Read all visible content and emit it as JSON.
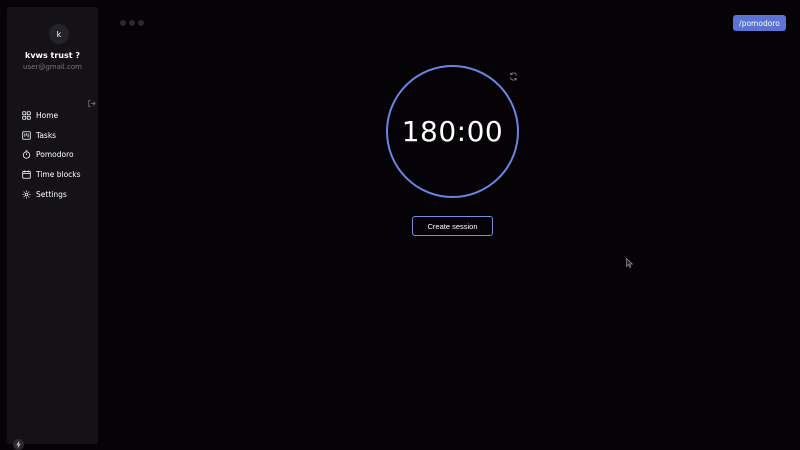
{
  "user": {
    "avatar_letter": "k",
    "name": "kvws trust ?",
    "email": "user@gmail.com"
  },
  "sidebar": {
    "items": [
      {
        "label": "Home",
        "icon": "grid-icon"
      },
      {
        "label": "Tasks",
        "icon": "kanban-icon"
      },
      {
        "label": "Pomodoro",
        "icon": "timer-icon"
      },
      {
        "label": "Time blocks",
        "icon": "calendar-icon"
      },
      {
        "label": "Settings",
        "icon": "gear-icon"
      }
    ]
  },
  "header": {
    "route": "/pomodoro"
  },
  "timer": {
    "display": "180:00"
  },
  "actions": {
    "create_session": "Create session"
  },
  "colors": {
    "background": "#060307",
    "sidebar": "#141217",
    "accent": "#5b74d3",
    "ring": "#6a84e0"
  }
}
